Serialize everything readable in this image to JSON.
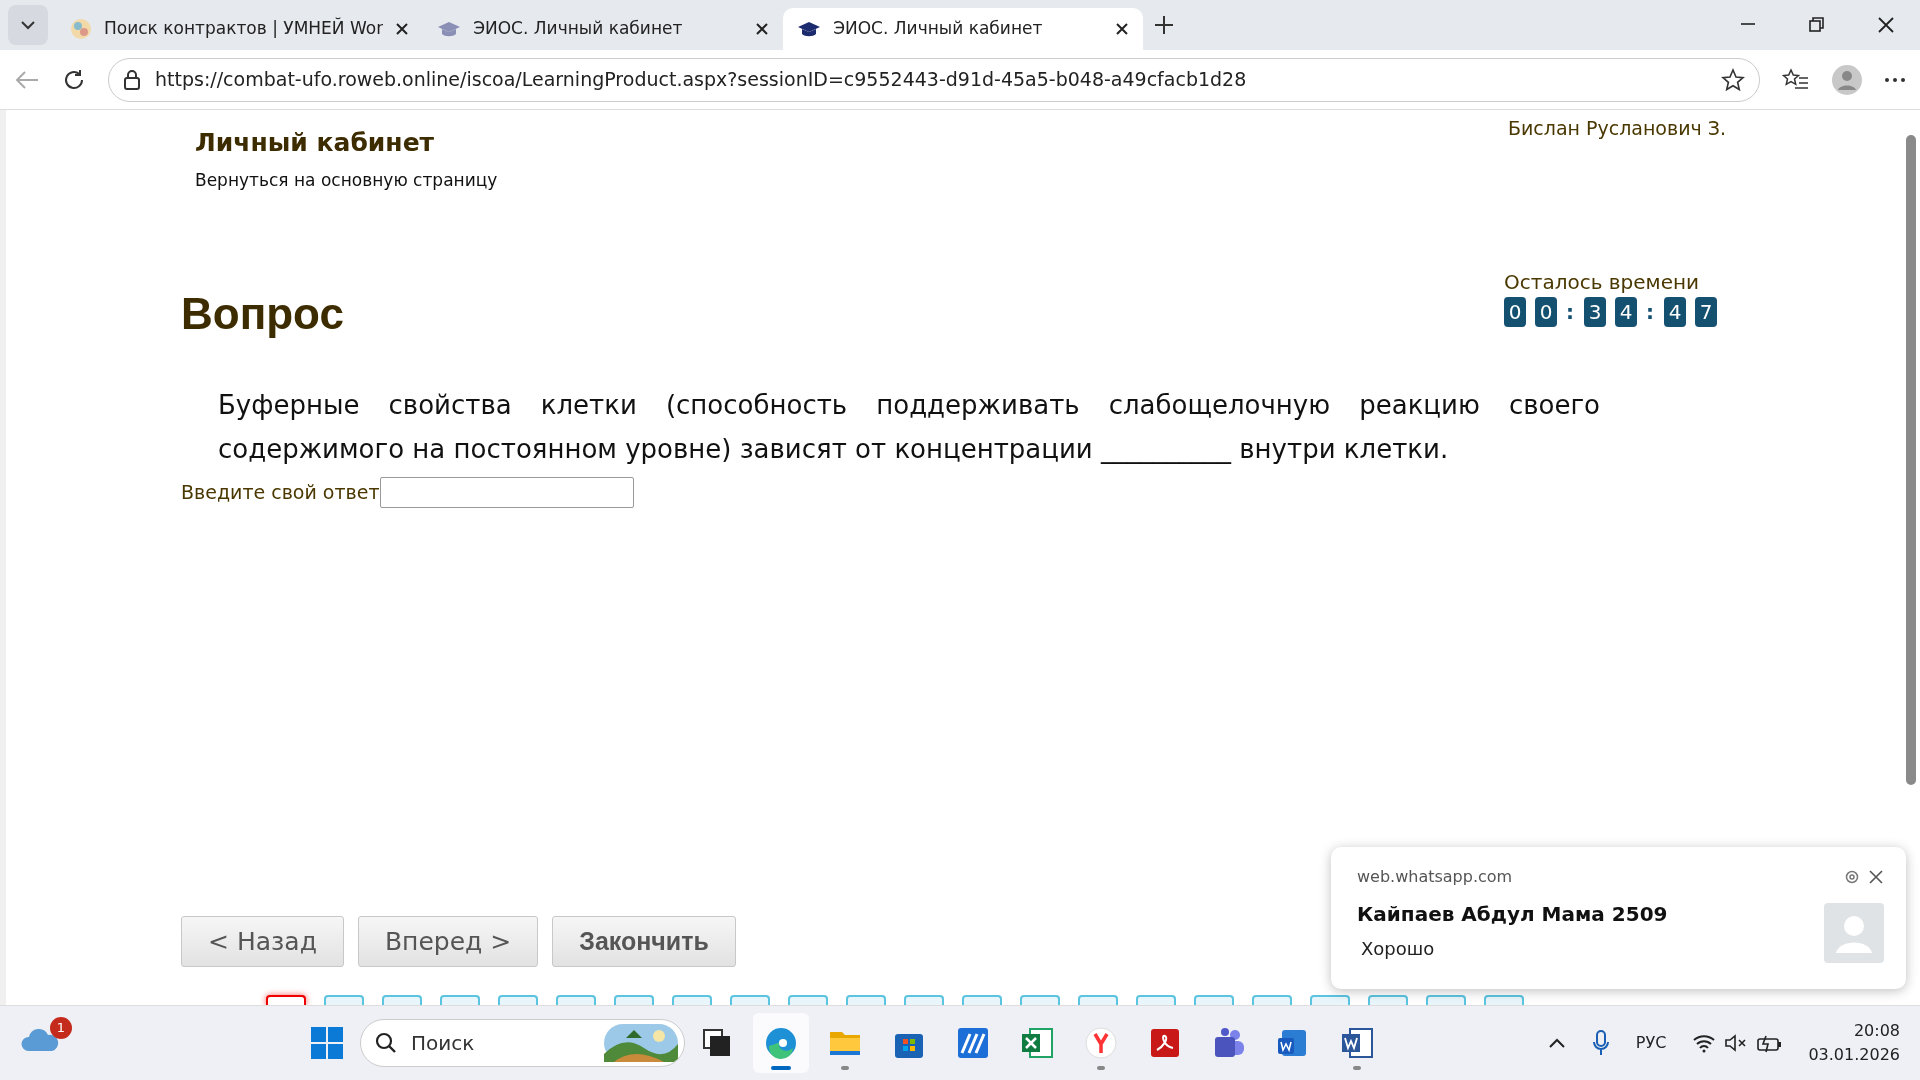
{
  "browser": {
    "tabs": [
      {
        "title": "Поиск контрактов | УМНЕЙ Wor",
        "kind": "globe",
        "selected": false
      },
      {
        "title": "ЭИОС. Личный кабинет",
        "kind": "cap",
        "selected": false
      },
      {
        "title": "ЭИОС. Личный кабинет",
        "kind": "cap",
        "selected": true
      }
    ],
    "url": "https://combat-ufo.roweb.online/iscoa/LearningProduct.aspx?sessionID=c9552443-d91d-45a5-b048-a49cfacb1d28"
  },
  "page": {
    "title": "Личный кабинет",
    "back_link": "Вернуться на основную страницу",
    "user_name": "Бислан Русланович З.",
    "timer": {
      "label": "Осталось времени",
      "cells": [
        {
          "kind": "digit",
          "text": "0"
        },
        {
          "kind": "digit",
          "text": "0"
        },
        {
          "kind": "sep",
          "text": ":"
        },
        {
          "kind": "digit",
          "text": "3"
        },
        {
          "kind": "digit",
          "text": "4"
        },
        {
          "kind": "sep",
          "text": ":"
        },
        {
          "kind": "digit",
          "text": "4"
        },
        {
          "kind": "digit",
          "text": "7"
        }
      ]
    },
    "heading": "Вопрос",
    "question": "Буферные свойства клетки (способность поддерживать слабощелочную реакцию своего содержимого на постоянном уровне) зависят от концентрации __________ внутри клетки.",
    "answer_label": "Введите свой ответ",
    "buttons": [
      {
        "label": "< Назад",
        "bold": false
      },
      {
        "label": "Вперед >",
        "bold": false
      },
      {
        "label": "Закончить",
        "bold": true
      }
    ],
    "question_nav": [
      {
        "selected": true
      },
      {
        "selected": false
      },
      {
        "selected": false
      },
      {
        "selected": false
      },
      {
        "selected": false
      },
      {
        "selected": false
      },
      {
        "selected": false
      },
      {
        "selected": false
      },
      {
        "selected": false
      },
      {
        "selected": false
      },
      {
        "selected": false
      },
      {
        "selected": false
      },
      {
        "selected": false
      },
      {
        "selected": false
      },
      {
        "selected": false
      },
      {
        "selected": false
      },
      {
        "selected": false
      },
      {
        "selected": false
      },
      {
        "selected": false
      },
      {
        "selected": false
      },
      {
        "selected": false
      },
      {
        "selected": false
      }
    ]
  },
  "notification": {
    "source": "web.whatsapp.com",
    "title": "Кайпаев Абдул Мама 2509",
    "message": "Хорошо"
  },
  "taskbar": {
    "weather_badge": "1",
    "search_placeholder": "Поиск",
    "apps": [
      {
        "kind": "squares",
        "running": false,
        "active": false
      },
      {
        "kind": "swirl",
        "running": true,
        "active": true
      },
      {
        "kind": "folder",
        "running": true,
        "active": false
      },
      {
        "kind": "bag",
        "running": false,
        "active": false
      },
      {
        "kind": "stripes",
        "running": false,
        "active": false
      },
      {
        "kind": "sheet",
        "running": false,
        "active": false
      },
      {
        "kind": "ylogo",
        "running": true,
        "active": false
      },
      {
        "kind": "reddoc",
        "running": false,
        "active": false
      },
      {
        "kind": "people",
        "running": false,
        "active": false
      },
      {
        "kind": "bluedoc",
        "running": false,
        "active": false
      },
      {
        "kind": "worddoc",
        "running": true,
        "active": false
      }
    ],
    "language": "РУС",
    "time": "20:08",
    "date": "03.01.2026"
  }
}
